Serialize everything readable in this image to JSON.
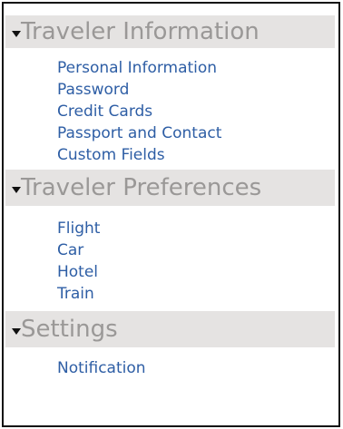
{
  "sections": [
    {
      "title": "Traveler Information",
      "items": [
        "Personal Information",
        "Password",
        "Credit Cards",
        "Passport and Contact",
        "Custom Fields"
      ]
    },
    {
      "title": "Traveler Preferences",
      "items": [
        "Flight",
        "Car",
        "Hotel",
        "Train"
      ]
    },
    {
      "title": "Settings",
      "items": [
        "Notification"
      ]
    }
  ],
  "colors": {
    "header_bg": "#e5e3e2",
    "header_text": "#9a9897",
    "link_text": "#2e5ea5",
    "border": "#111111"
  }
}
